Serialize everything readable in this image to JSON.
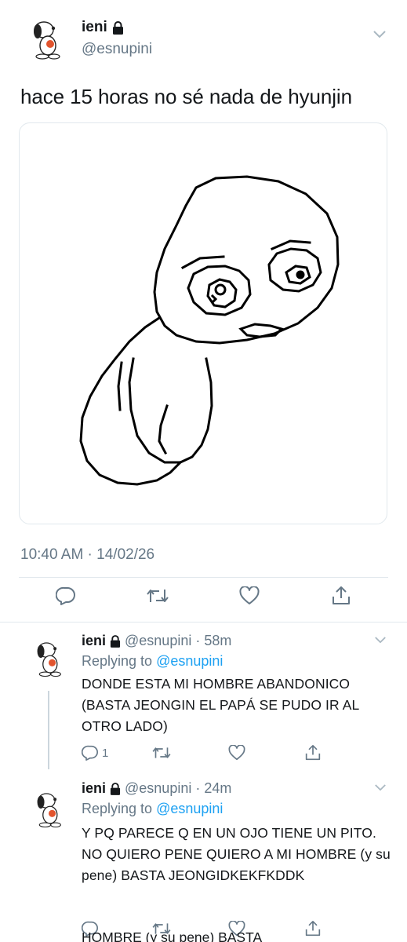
{
  "main_tweet": {
    "display_name": "ieni",
    "handle": "@esnupini",
    "text": "hace 15 horas no sé nada de hyunjin",
    "timestamp": "10:40 AM · 14/02/26",
    "icons": [
      "avatar-snoopy",
      "lock-icon",
      "chevron-down-icon",
      "reply-icon",
      "retweet-icon",
      "like-icon",
      "share-icon"
    ]
  },
  "replies": [
    {
      "display_name": "ieni",
      "handle": "@esnupini",
      "time": "58m",
      "replying_prefix": "Replying to",
      "replying_to": "@esnupini",
      "text": "DONDE ESTA MI HOMBRE ABANDONICO (BASTA JEONGIN EL PAPÁ SE PUDO IR AL OTRO LADO)",
      "reply_count": "1"
    },
    {
      "display_name": "ieni",
      "handle": "@esnupini",
      "time": "24m",
      "replying_prefix": "Replying to",
      "replying_to": "@esnupini",
      "text": "Y PQ PARECE Q EN UN OJO TIENE UN PITO. NO QUIERO PENE QUIERO A MI HOMBRE (y su pene) BASTA JEONGIDKEKFKDDK",
      "reply_count": ""
    }
  ],
  "cutoff_text": "HOMBRE (y su pene) BASTA",
  "colors": {
    "text": "#14171a",
    "muted": "#657786",
    "link": "#1da1f2",
    "border": "#e1e8ed"
  }
}
